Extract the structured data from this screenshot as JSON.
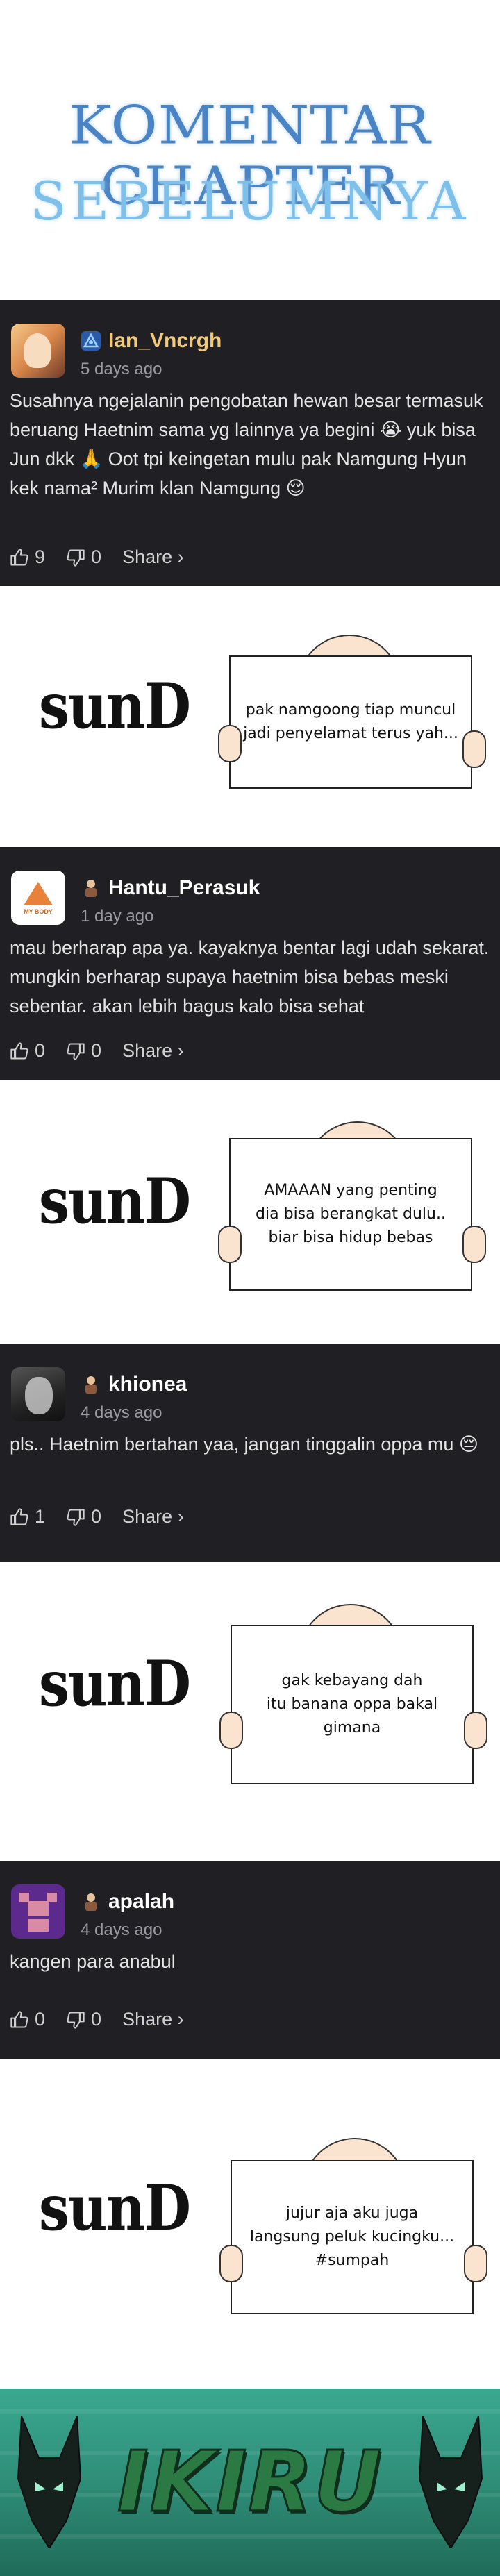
{
  "header": {
    "line1": "KOMENTAR CHAPTER",
    "line2": "SEBELUMNYA"
  },
  "comments": [
    {
      "username": "Ian_Vncrgh",
      "time": "5 days ago",
      "text": "Susahnya ngejalanin pengobatan hewan besar termasuk beruang Haetnim sama yg lainnya ya begini 😭 yuk bisa Jun dkk 🙏 Oot tpi keingetan mulu pak Namgung Hyun kek nama² Murim klan Namgung 😌",
      "likes": "9",
      "dislikes": "0",
      "share": "Share ›"
    },
    {
      "username": "Hantu_Perasuk",
      "time": "1 day ago",
      "text": "mau berharap apa ya. kayaknya bentar lagi udah sekarat. mungkin berharap supaya haetnim bisa bebas meski sebentar. akan lebih bagus kalo bisa sehat",
      "likes": "0",
      "dislikes": "0",
      "share": "Share ›",
      "avatar_text": "MY BODY"
    },
    {
      "username": "khionea",
      "time": "4 days ago",
      "text": "pls.. Haetnim bertahan yaa, jangan tinggalin oppa mu 😔",
      "likes": "1",
      "dislikes": "0",
      "share": "Share ›"
    },
    {
      "username": "apalah",
      "time": "4 days ago",
      "text": "kangen para anabul",
      "likes": "0",
      "dislikes": "0",
      "share": "Share ›"
    }
  ],
  "replies": [
    {
      "signature": "sunD",
      "sign_text": "pak namgoong tiap muncul\njadi penyelamat terus yah..."
    },
    {
      "signature": "sunD",
      "sign_text": "AMAAAN yang penting\ndia bisa berangkat dulu..\nbiar bisa hidup bebas"
    },
    {
      "signature": "sunD",
      "sign_text": "gak kebayang dah\nitu banana oppa bakal\ngimana"
    },
    {
      "signature": "sunD",
      "sign_text": "jujur aja aku juga\nlangsung peluk kucingku...\n#sumpah"
    }
  ],
  "banner": {
    "title": "IKIRU"
  },
  "colors": {
    "card_bg": "#1f1f24",
    "header_blue": "#4a84c4",
    "header_light_blue": "#7fc0ea",
    "banner_green": "#2f8e78"
  }
}
